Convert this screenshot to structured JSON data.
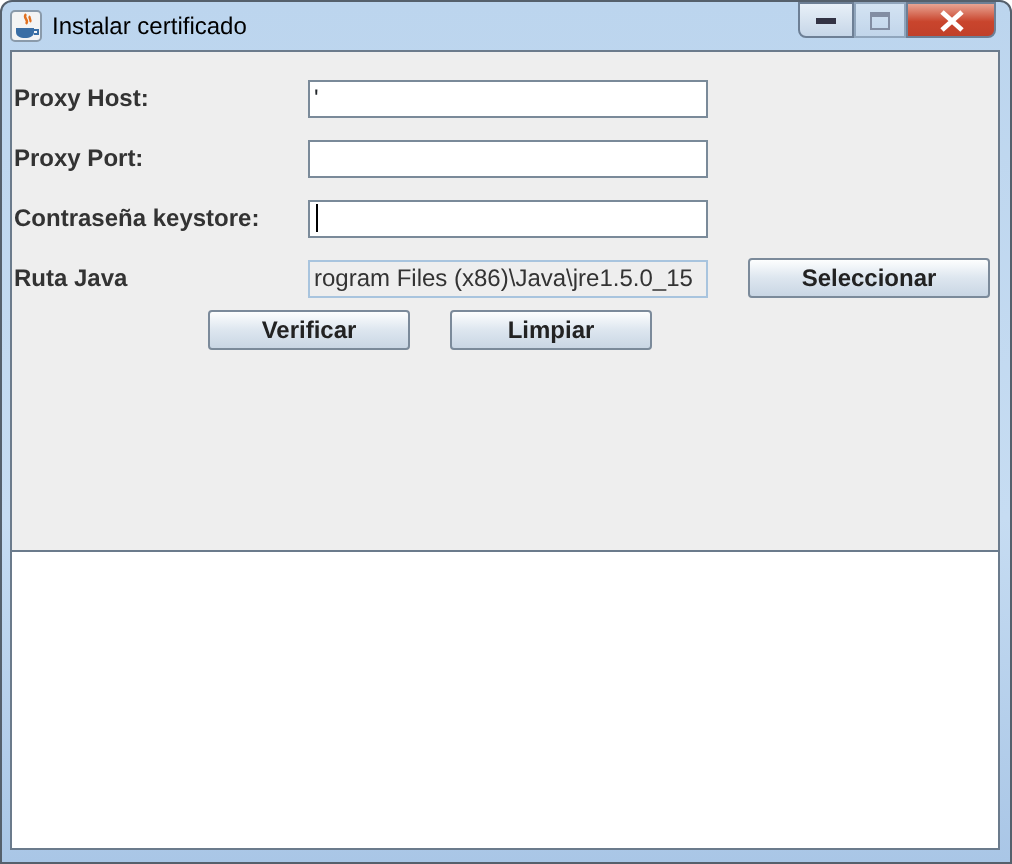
{
  "window": {
    "title": "Instalar certificado",
    "maximize_disabled": true
  },
  "fields": [
    {
      "label": "Proxy Host:",
      "value": "'",
      "focused": false,
      "editable": true
    },
    {
      "label": "Proxy Port:",
      "focused": false,
      "editable": true
    },
    {
      "label": "Contraseña keystore:",
      "focused": true,
      "editable": true
    },
    {
      "label": "Ruta Java",
      "value": "rogram Files (x86)\\Java\\jre1.5.0_15",
      "focused": false,
      "editable": false,
      "button": "Seleccionar"
    }
  ],
  "buttons": [
    "Verificar",
    "Limpiar"
  ]
}
